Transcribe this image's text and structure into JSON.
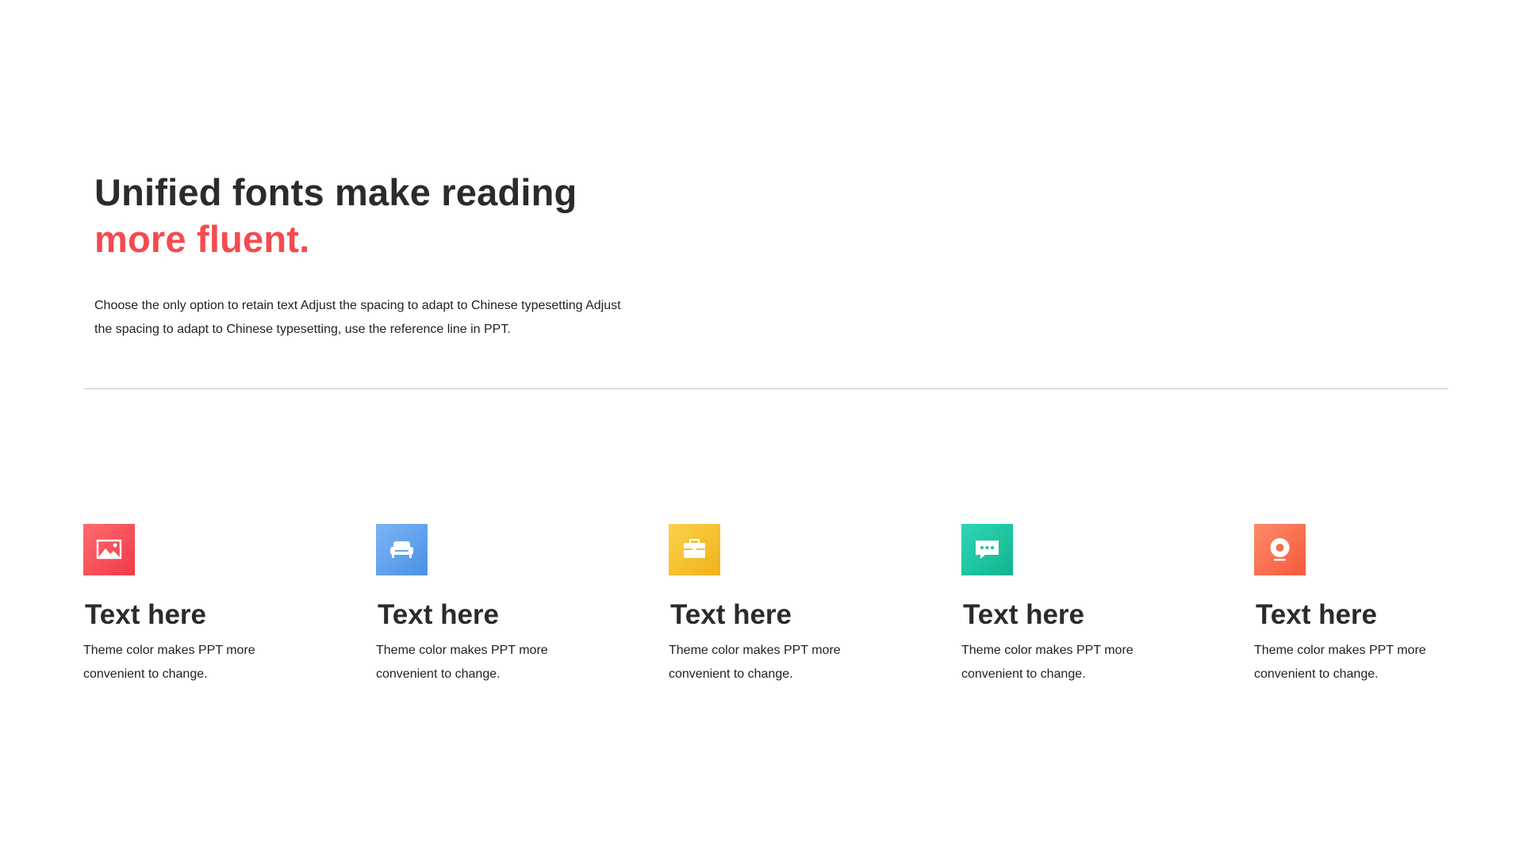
{
  "heading": {
    "line1": "Unified fonts make reading",
    "line2": "more fluent.",
    "accent_color": "#f44b4f"
  },
  "intro": "Choose the only option to retain text Adjust the spacing to adapt to Chinese typesetting Adjust the spacing to adapt to Chinese typesetting, use the reference line in PPT.",
  "features": [
    {
      "icon": "image-icon",
      "color_from": "#ff6b6e",
      "color_to": "#ee3b47",
      "title": "Text here",
      "text": "Theme color makes PPT more convenient to change."
    },
    {
      "icon": "sofa-icon",
      "color_from": "#7db5f5",
      "color_to": "#4a90e6",
      "title": "Text here",
      "text": "Theme color makes PPT more convenient to change."
    },
    {
      "icon": "briefcase-icon",
      "color_from": "#fbd24a",
      "color_to": "#f0b21a",
      "title": "Text here",
      "text": "Theme color makes PPT more convenient to change."
    },
    {
      "icon": "chat-icon",
      "color_from": "#2fd6b6",
      "color_to": "#12b48e",
      "title": "Text here",
      "text": "Theme color makes PPT more convenient to change."
    },
    {
      "icon": "webcam-icon",
      "color_from": "#ff8a6a",
      "color_to": "#f45a3c",
      "title": "Text here",
      "text": "Theme color makes PPT more convenient to change."
    }
  ]
}
